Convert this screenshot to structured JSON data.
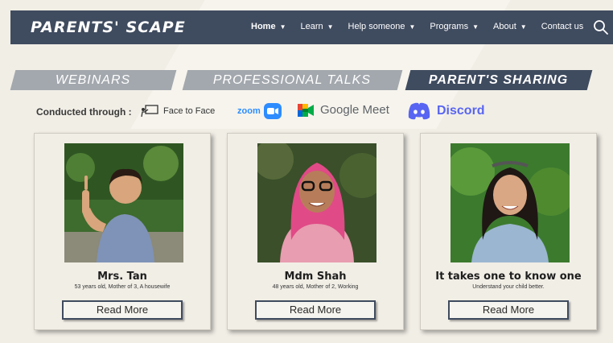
{
  "header": {
    "brand": "PARENTS' SCAPE",
    "menu": [
      {
        "label": "Home",
        "caret": "▼"
      },
      {
        "label": "Learn",
        "caret": "▼"
      },
      {
        "label": "Help someone",
        "caret": "▼"
      },
      {
        "label": "Programs",
        "caret": "▼"
      },
      {
        "label": "About",
        "caret": "▼"
      },
      {
        "label": "Contact us"
      }
    ],
    "search_icon": "search-icon"
  },
  "tabs": [
    {
      "label": "WEBINARS",
      "active": false
    },
    {
      "label": "PROFESSIONAL TALKS",
      "active": false
    },
    {
      "label": "PARENT'S SHARING",
      "active": true
    }
  ],
  "conducted": {
    "label": "Conducted through :",
    "face_to_face": "Face to Face",
    "zoom": "zoom",
    "google_meet": "Google Meet",
    "discord": "Discord"
  },
  "cards": [
    {
      "title": "Mrs. Tan",
      "subtitle": "53 years old, Mother of 3, A housewife",
      "button": "Read More"
    },
    {
      "title": "Mdm Shah",
      "subtitle": "48 years old, Mother of 2, Working",
      "button": "Read More"
    },
    {
      "title": "It takes one to know one",
      "subtitle": "Understand your child better.",
      "button": "Read More"
    }
  ],
  "colors": {
    "nav_bg": "#3f4b5f",
    "page_bg": "#f1eee6",
    "tab_inactive": "#a3a8ae",
    "zoom_blue": "#2d8cff",
    "discord_blurple": "#5865f2"
  }
}
